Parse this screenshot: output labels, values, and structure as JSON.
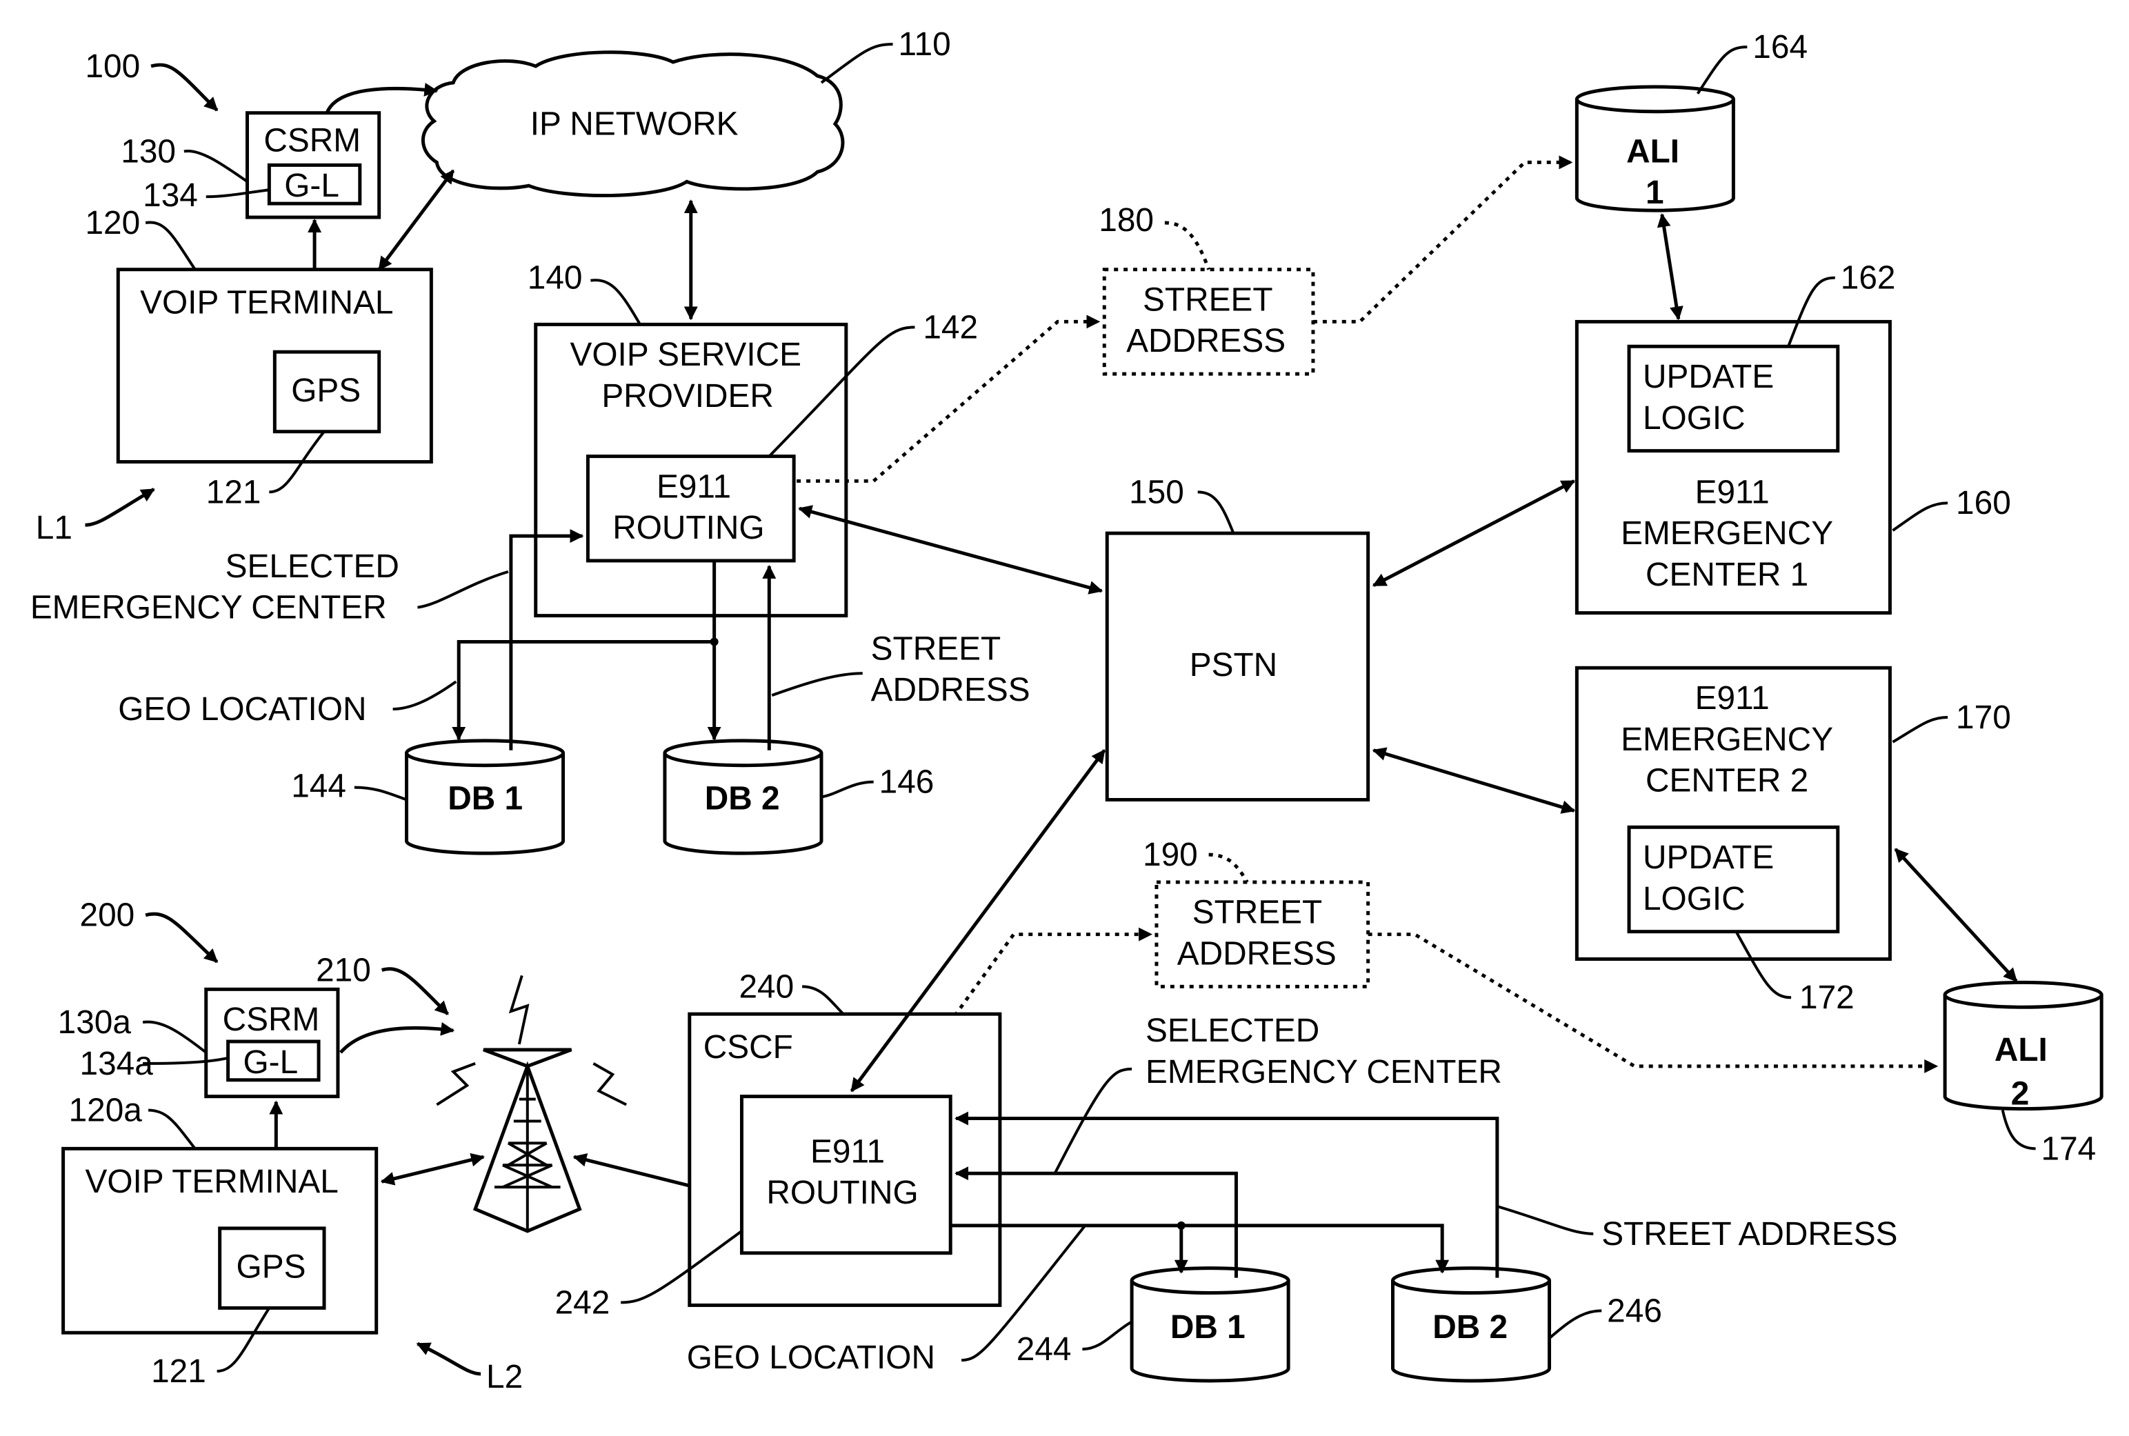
{
  "figure": {
    "ref_labels": {
      "system_1": "100",
      "ip_network": "110",
      "voip_terminal_1": "120",
      "gps_1": "121",
      "csrm_1": "130",
      "gl_1": "134",
      "voip_service_provider": "140",
      "e911_routing_1": "142",
      "db1_top": "144",
      "db2_top": "146",
      "pstn": "150",
      "emergency_center_1": "160",
      "update_logic_1": "162",
      "ali_1": "164",
      "emergency_center_2": "170",
      "update_logic_2": "172",
      "ali_2": "174",
      "street_address_1": "180",
      "street_address_2": "190",
      "system_2": "200",
      "cell_tower": "210",
      "voip_terminal_2": "120a",
      "gps_2": "121",
      "csrm_2": "130a",
      "gl_2": "134a",
      "cscf": "240",
      "e911_routing_2": "242",
      "db1_bottom": "244",
      "db2_bottom": "246",
      "location_1": "L1",
      "location_2": "L2"
    },
    "blocks": {
      "ip_network": "IP NETWORK",
      "csrm": "CSRM",
      "gl": "G-L",
      "voip_terminal": "VOIP TERMINAL",
      "gps": "GPS",
      "vsp_line1": "VOIP SERVICE",
      "vsp_line2": "PROVIDER",
      "e911_line1": "E911",
      "routing_line2": "ROUTING",
      "db1": "DB 1",
      "db2": "DB 2",
      "pstn": "PSTN",
      "street": "STREET",
      "address": "ADDRESS",
      "ali": "ALI",
      "ali_1_num": "1",
      "ali_2_num": "2",
      "update": "UPDATE",
      "logic": "LOGIC",
      "emergency": "EMERGENCY",
      "center_1": "CENTER 1",
      "center_2": "CENTER 2",
      "cscf": "CSCF"
    },
    "annotations": {
      "selected": "SELECTED",
      "emergency_center": "EMERGENCY CENTER",
      "geo_location": "GEO LOCATION",
      "street": "STREET",
      "address": "ADDRESS",
      "street_address": "STREET ADDRESS"
    }
  }
}
